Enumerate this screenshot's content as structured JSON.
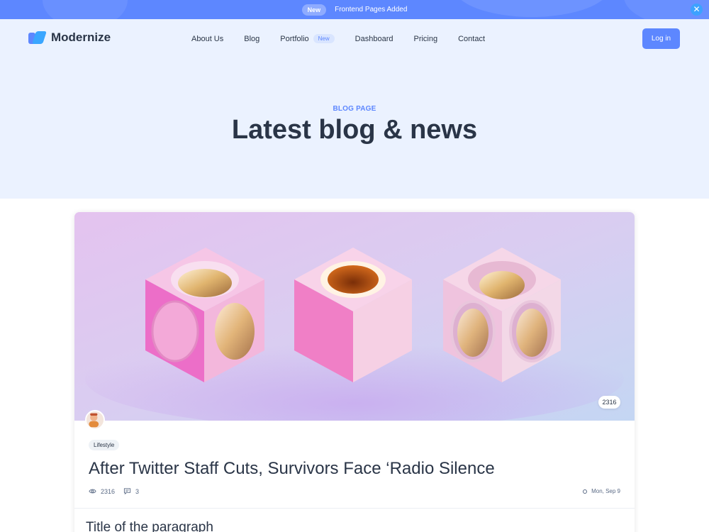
{
  "announcement": {
    "badge": "New",
    "message": "Frontend Pages Added",
    "close_icon": "close-icon"
  },
  "brand": {
    "name": "Modernize",
    "accent": "#5d87ff"
  },
  "nav": {
    "items": [
      {
        "label": "About Us"
      },
      {
        "label": "Blog"
      },
      {
        "label": "Portfolio",
        "badge": "New"
      },
      {
        "label": "Dashboard"
      },
      {
        "label": "Pricing"
      },
      {
        "label": "Contact"
      }
    ],
    "login": "Log in"
  },
  "hero": {
    "eyebrow": "BLOG PAGE",
    "title": "Latest blog & news"
  },
  "post": {
    "views_badge": "2316",
    "category": "Lifestyle",
    "title": "After Twitter Staff Cuts, Survivors Face ‘Radio Silence",
    "views": "2316",
    "comments": "3",
    "date": "Mon, Sep 9",
    "section_title": "Title of the paragraph"
  }
}
